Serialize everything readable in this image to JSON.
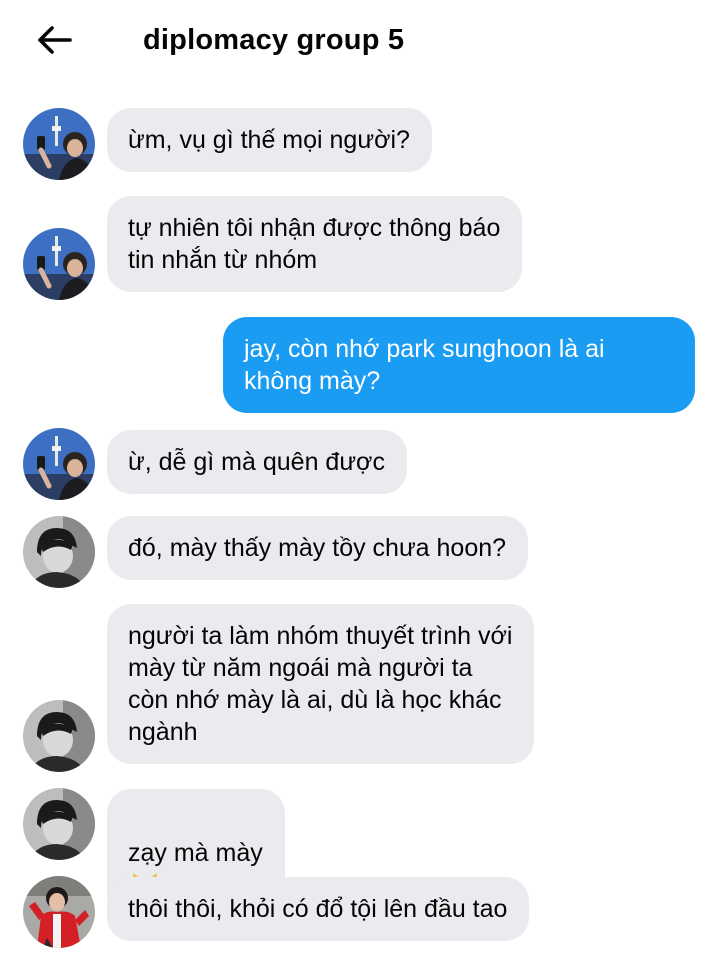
{
  "header": {
    "title": "diplomacy group 5",
    "back_icon": "arrow-left-icon"
  },
  "messages": [
    {
      "sender": "other",
      "avatar": "avatar-tower-selfie",
      "text": "ừm, vụ gì thế mọi người?"
    },
    {
      "sender": "other",
      "avatar": "avatar-tower-selfie",
      "text": "tự nhiên tôi nhận được thông báo\ntin nhắn từ nhóm"
    },
    {
      "sender": "me",
      "text": "jay, còn nhớ park sunghoon là ai\nkhông mày?"
    },
    {
      "sender": "other",
      "avatar": "avatar-tower-selfie",
      "text": "ừ, dễ gì mà quên được"
    },
    {
      "sender": "other",
      "avatar": "avatar-bw-boy",
      "text": "đó, mày thấy mày tồy chưa hoon?"
    },
    {
      "sender": "other",
      "avatar": "avatar-bw-boy",
      "text": "người ta làm nhóm thuyết trình với\nmày từ năm ngoái mà người ta\ncòn nhớ mày là ai, dù là học khác\nngành"
    },
    {
      "sender": "other",
      "avatar": "avatar-bw-boy",
      "text": "zạy mà mày",
      "emoji": "smirking-cat-icon"
    },
    {
      "sender": "other",
      "avatar": "avatar-red-jacket",
      "text": "thôi thôi, khỏi có đổ tội lên đầu tao"
    }
  ],
  "colors": {
    "incoming_bubble": "#e9ebee",
    "outgoing_bubble": "#1a9cf2",
    "text": "#050505"
  }
}
